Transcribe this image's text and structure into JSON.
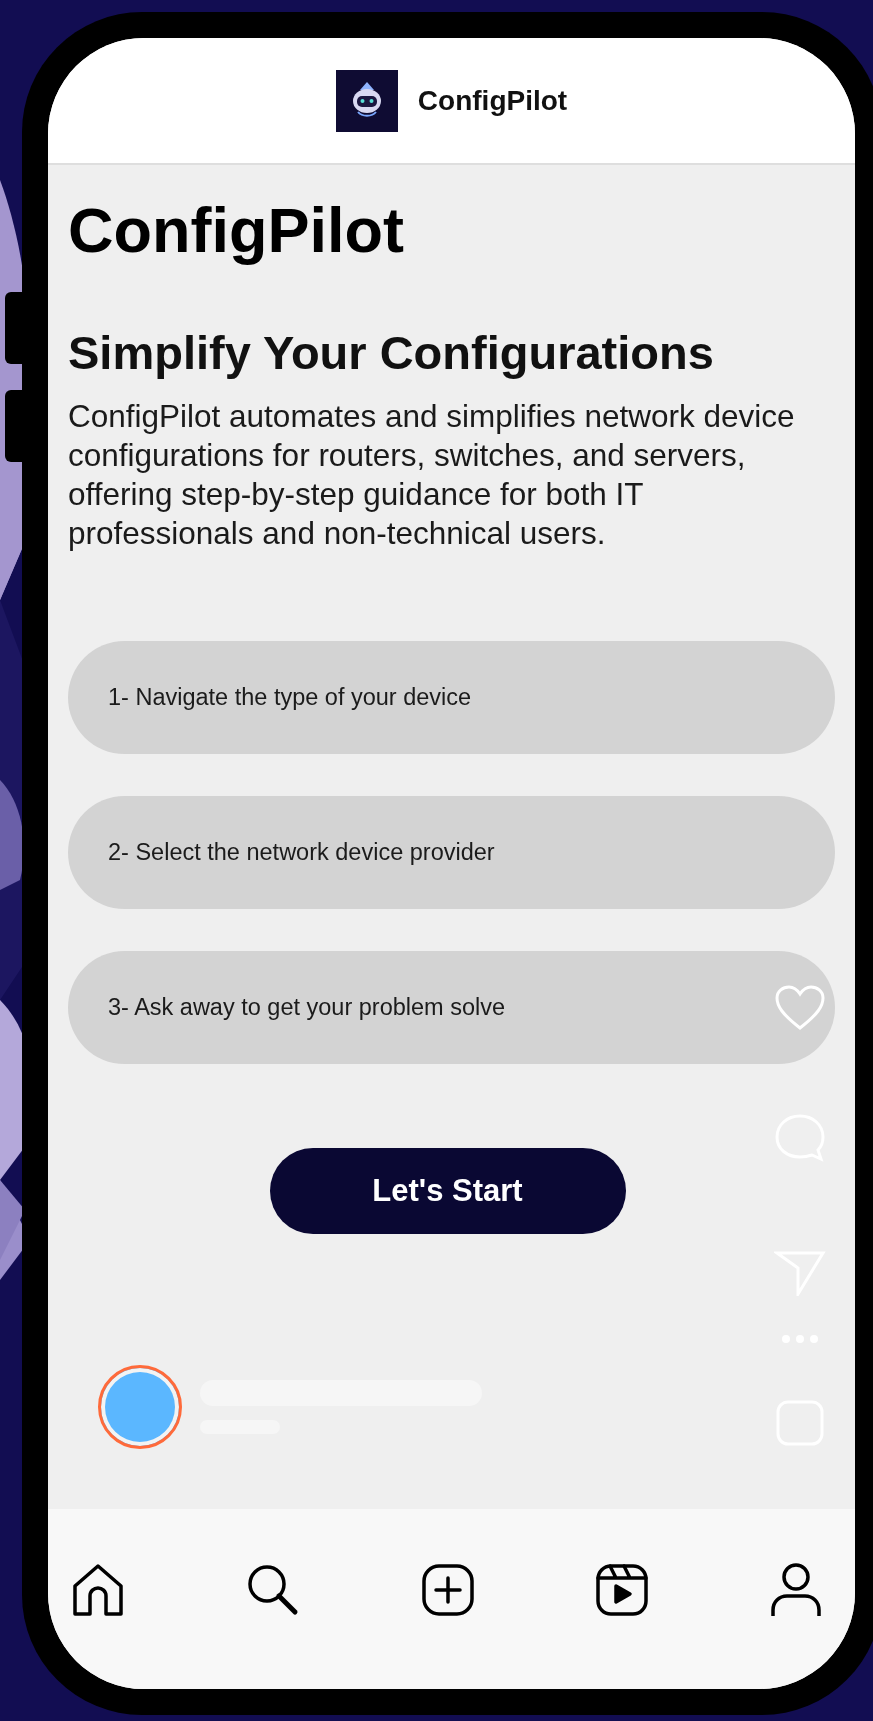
{
  "header": {
    "title": "ConfigPilot"
  },
  "title": "ConfigPilot",
  "subtitle": "Simplify Your Configurations",
  "description": "ConfigPilot automates and simplifies network device configurations for routers, switches, and servers, offering step-by-step guidance for both IT professionals and non-technical users.",
  "steps": [
    "1- Navigate the type of your device",
    "2- Select the network device provider",
    "3- Ask away to get your problem solve"
  ],
  "start_button": {
    "label": "Let's Start"
  },
  "side_actions": [
    {
      "kind": "like"
    },
    {
      "kind": "comment"
    },
    {
      "kind": "share"
    },
    {
      "kind": "more"
    },
    {
      "kind": "audio"
    }
  ],
  "nav": [
    {
      "kind": "home"
    },
    {
      "kind": "search"
    },
    {
      "kind": "create"
    },
    {
      "kind": "reels"
    },
    {
      "kind": "profile"
    }
  ]
}
